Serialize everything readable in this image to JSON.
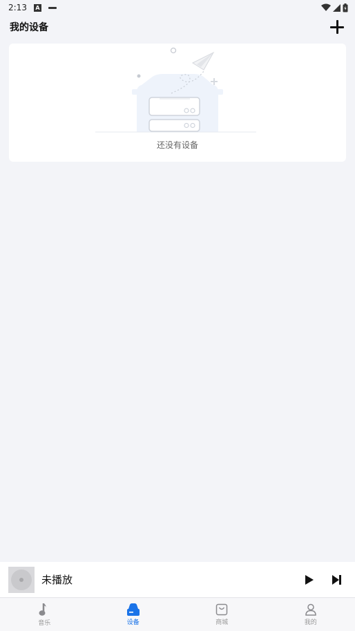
{
  "status_bar": {
    "time": "2:13",
    "badge": "A"
  },
  "header": {
    "title": "我的设备",
    "add_icon": "plus-icon"
  },
  "empty_state": {
    "message": "还没有设备",
    "illustration": "paper-plane-device-illustration"
  },
  "player": {
    "track_title": "未播放",
    "play_icon": "play-icon",
    "next_icon": "skip-next-icon"
  },
  "tabs": [
    {
      "label": "音乐",
      "icon": "music-note-icon",
      "active": false
    },
    {
      "label": "设备",
      "icon": "device-icon",
      "active": true
    },
    {
      "label": "商城",
      "icon": "shopping-bag-icon",
      "active": false
    },
    {
      "label": "我的",
      "icon": "person-icon",
      "active": false
    }
  ],
  "colors": {
    "accent": "#1a73e8",
    "background": "#f3f4f8",
    "inactive": "#999999"
  }
}
